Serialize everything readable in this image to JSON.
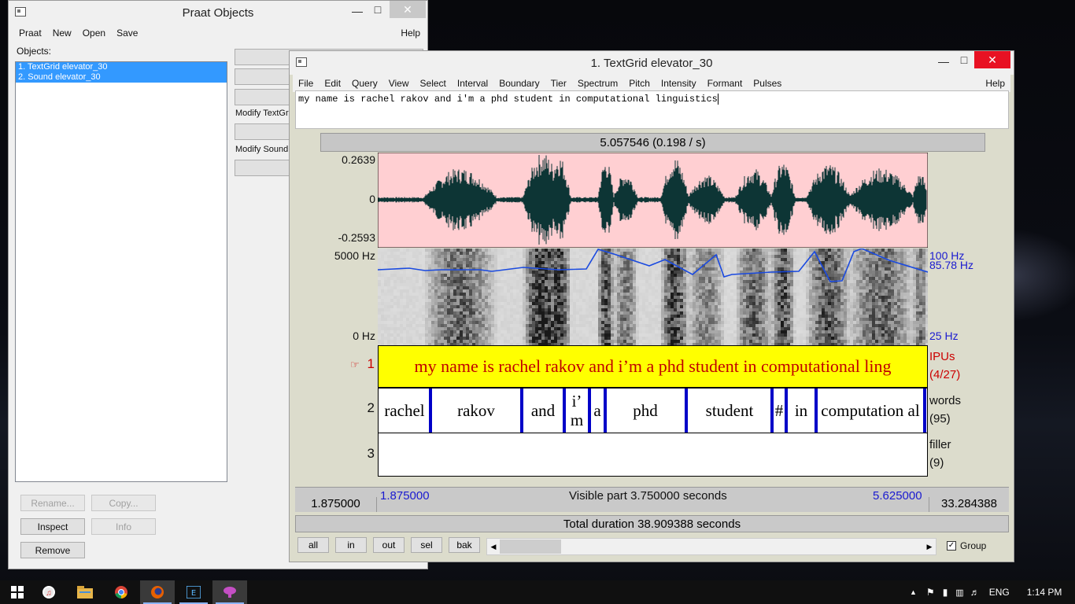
{
  "objects_window": {
    "title": "Praat Objects",
    "menu": [
      "Praat",
      "New",
      "Open",
      "Save"
    ],
    "help": "Help",
    "objects_label": "Objects:",
    "items": [
      "1. TextGrid elevator_30",
      "2. Sound elevator_30"
    ],
    "modify_textgrid_label": "Modify TextGri",
    "modify_sound_label": "Modify Sound",
    "buttons": {
      "rename": "Rename...",
      "copy": "Copy...",
      "inspect": "Inspect",
      "info": "Info",
      "remove": "Remove"
    }
  },
  "editor": {
    "title": "1. TextGrid elevator_30",
    "menu": [
      "File",
      "Edit",
      "Query",
      "View",
      "Select",
      "Interval",
      "Boundary",
      "Tier",
      "Spectrum",
      "Pitch",
      "Intensity",
      "Formant",
      "Pulses"
    ],
    "help": "Help",
    "text_field": "my name is rachel rakov and i'm a phd student in computational linguistics",
    "cursor_readout": "5.057546 (0.198 / s)",
    "waveform": {
      "max": "0.2639",
      "zero": "0",
      "min": "-0.2593"
    },
    "spectrogram": {
      "top": "5000 Hz",
      "bottom": "0 Hz",
      "pitch_top": "100 Hz",
      "pitch_value": "85.78 Hz",
      "pitch_bottom": "25 Hz"
    },
    "tiers": [
      {
        "number": "1",
        "name": "IPUs",
        "count": "(4/27)",
        "intervals": [
          "my name is rachel rakov and i’m a phd student in computational ling"
        ]
      },
      {
        "number": "2",
        "name": "words",
        "count": "(95)",
        "intervals": [
          "rachel",
          "rakov",
          "and",
          "i’ m",
          "a",
          "phd",
          "student",
          "#",
          "in",
          "computation al"
        ]
      },
      {
        "number": "3",
        "name": "filler",
        "count": "(9)",
        "intervals": []
      }
    ],
    "time": {
      "window_start": "1.875000",
      "visible_start": "1.875000",
      "visible_part": "Visible part 3.750000 seconds",
      "visible_end": "5.625000",
      "window_end": "33.284388",
      "total": "Total duration 38.909388 seconds"
    },
    "nav_buttons": [
      "all",
      "in",
      "out",
      "sel",
      "bak"
    ],
    "group_label": "Group",
    "group_checked": true
  },
  "taskbar": {
    "apps": [
      "start-icon",
      "itunes-icon",
      "file-explorer-icon",
      "chrome-icon",
      "firefox-icon",
      "e-app-icon",
      "praat-icon"
    ],
    "language": "ENG",
    "time": "1:14 PM"
  }
}
